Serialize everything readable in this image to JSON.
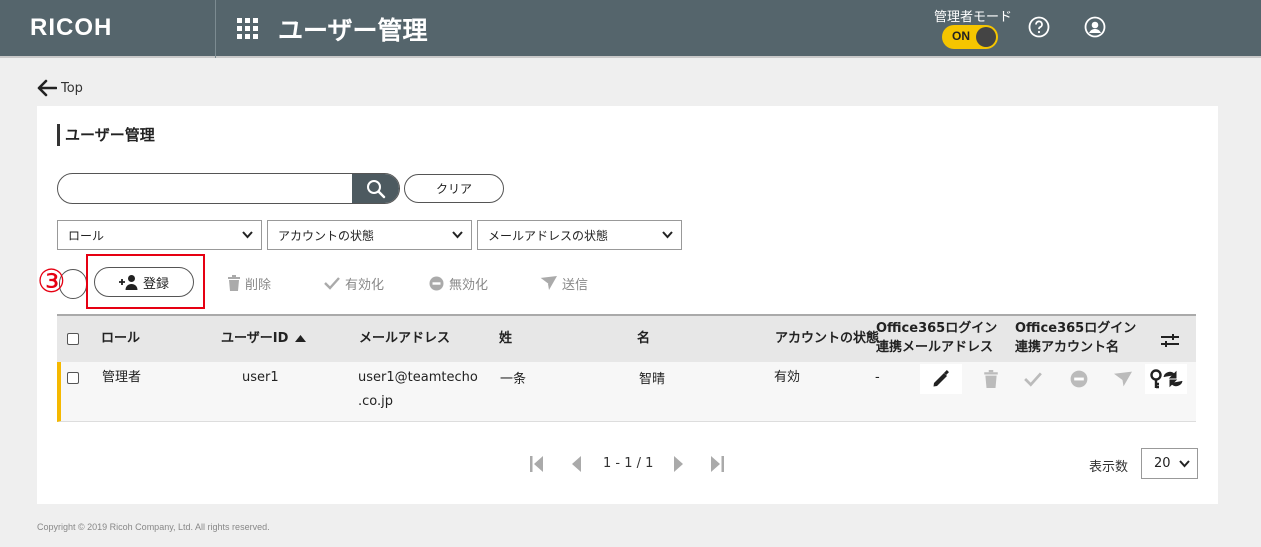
{
  "header": {
    "logo": "RICOH",
    "title": "ユーザー管理",
    "admin_mode_label": "管理者モード",
    "admin_mode_toggle": "ON"
  },
  "nav": {
    "back_label": "Top"
  },
  "page": {
    "title": "ユーザー管理"
  },
  "search": {
    "placeholder": "",
    "clear_label": "クリア"
  },
  "filters": [
    {
      "label": "ロール"
    },
    {
      "label": "アカウントの状態"
    },
    {
      "label": "メールアドレスの状態"
    }
  ],
  "annotation": {
    "step_marker": "③"
  },
  "toolbar": {
    "register": "登録",
    "delete": "削除",
    "enable": "有効化",
    "disable": "無効化",
    "send": "送信"
  },
  "table": {
    "headers": {
      "role": "ロール",
      "user_id": "ユーザーID",
      "email": "メールアドレス",
      "last_name": "姓",
      "first_name": "名",
      "account_status": "アカウントの状態",
      "o365_email_1": "Office365ログイン",
      "o365_email_2": "連携メールアドレス",
      "o365_account_1": "Office365ログイン",
      "o365_account_2": "連携アカウント名"
    },
    "rows": [
      {
        "role": "管理者",
        "user_id": "user1",
        "email_line1": "user1@teamtecho",
        "email_line2": ".co.jp",
        "last_name": "一条",
        "first_name": "智晴",
        "account_status": "有効",
        "o365_email": "-"
      }
    ]
  },
  "pager": {
    "range": "1 - 1 / 1",
    "count_label": "表示数",
    "count_value": "20"
  },
  "footer": {
    "copyright": "Copyright © 2019 Ricoh Company, Ltd. All rights reserved."
  },
  "colors": {
    "header_bg": "#55656c",
    "toggle_accent": "#f5c500",
    "highlight": "#e60012",
    "row_marker": "#f5b800"
  }
}
